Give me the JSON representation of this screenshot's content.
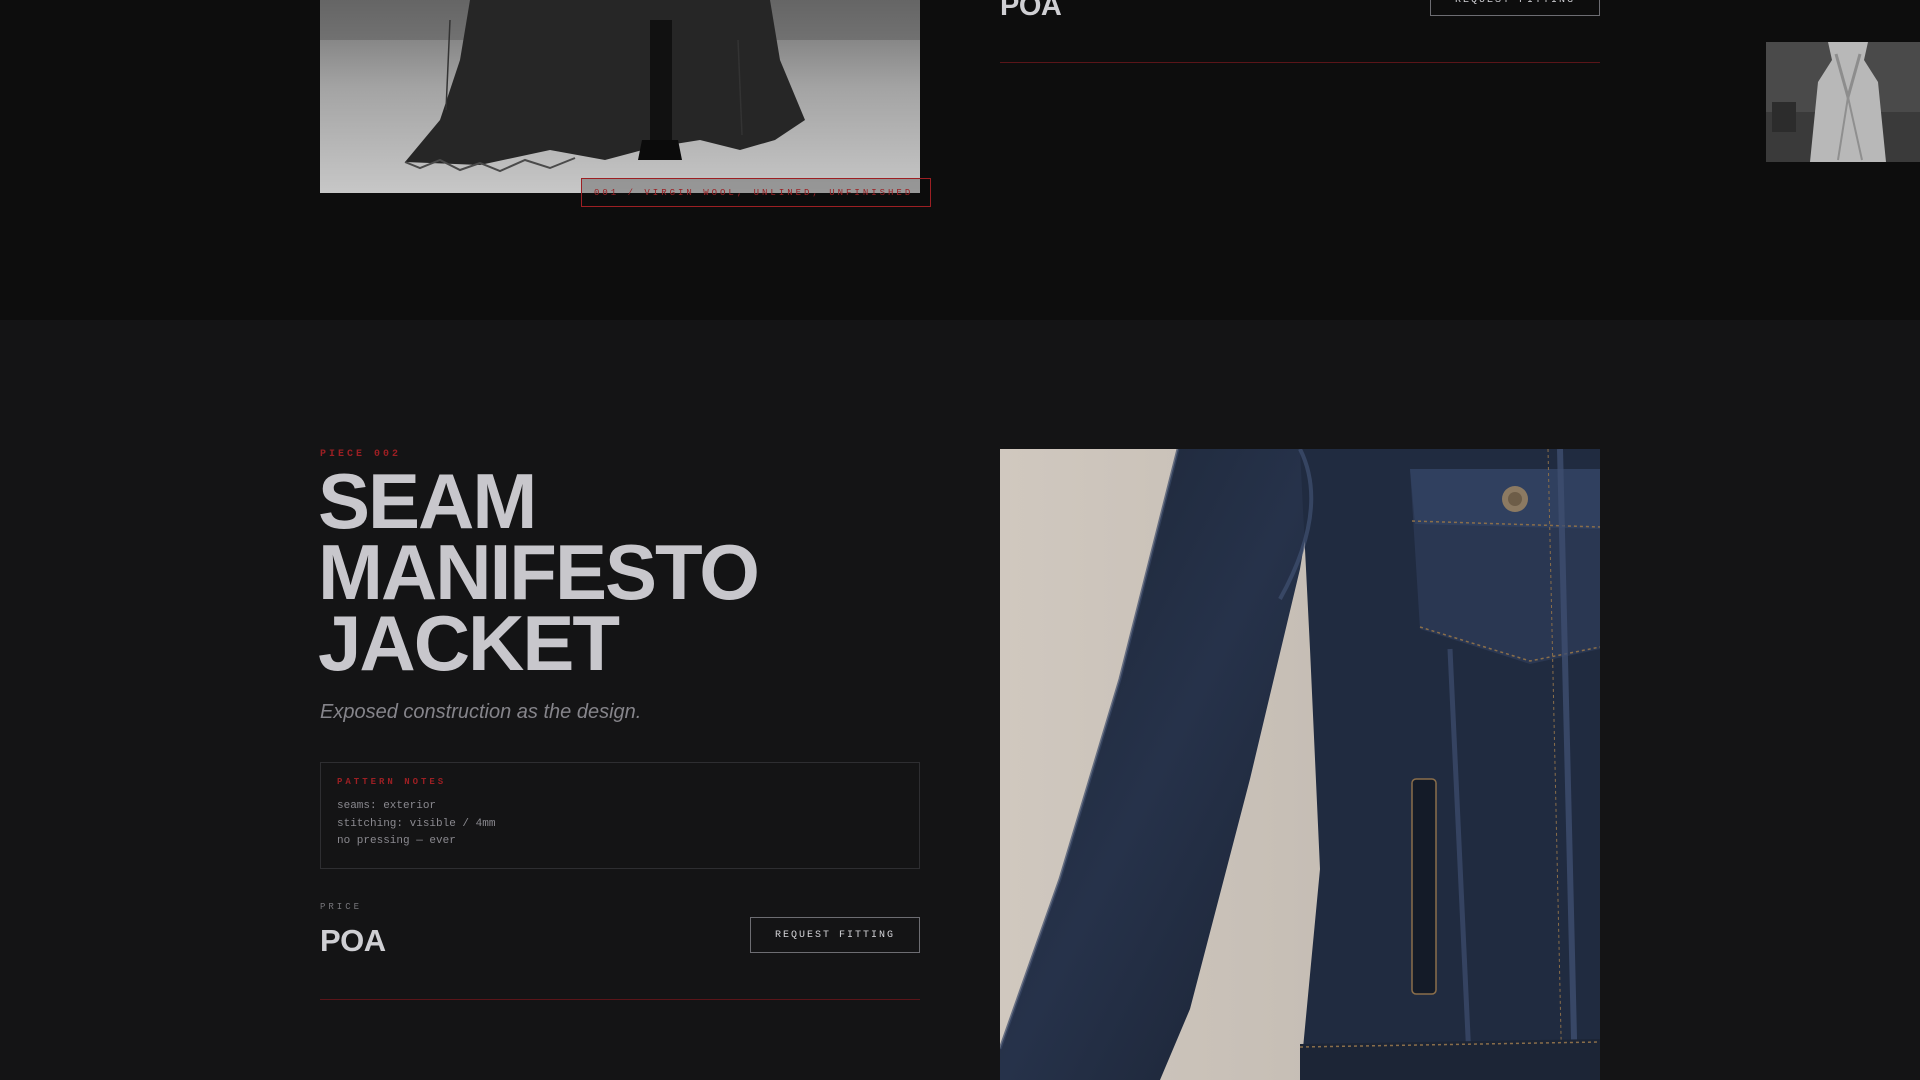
{
  "previous_piece": {
    "caption": "001 / VIRGIN WOOL, UNLINED, UNFINISHED",
    "price": "POA",
    "fitting_button": "REQUEST FITTING"
  },
  "piece": {
    "number": "PIECE 002",
    "title_lines": [
      "SEAM",
      "MANIFESTO",
      "JACKET"
    ],
    "subtitle": "Exposed construction as the design.",
    "pattern_notes": {
      "title": "PATTERN NOTES",
      "lines": [
        "seams: exterior",
        "stitching: visible / 4mm",
        "no pressing — ever"
      ]
    },
    "price_label": "PRICE",
    "price": "POA",
    "fitting_button": "REQUEST FITTING"
  },
  "colors": {
    "accent_red": "#9c1f23",
    "background_dark": "#0d0d0d",
    "section_background": "#141415",
    "text_light": "#c8c7cc"
  }
}
